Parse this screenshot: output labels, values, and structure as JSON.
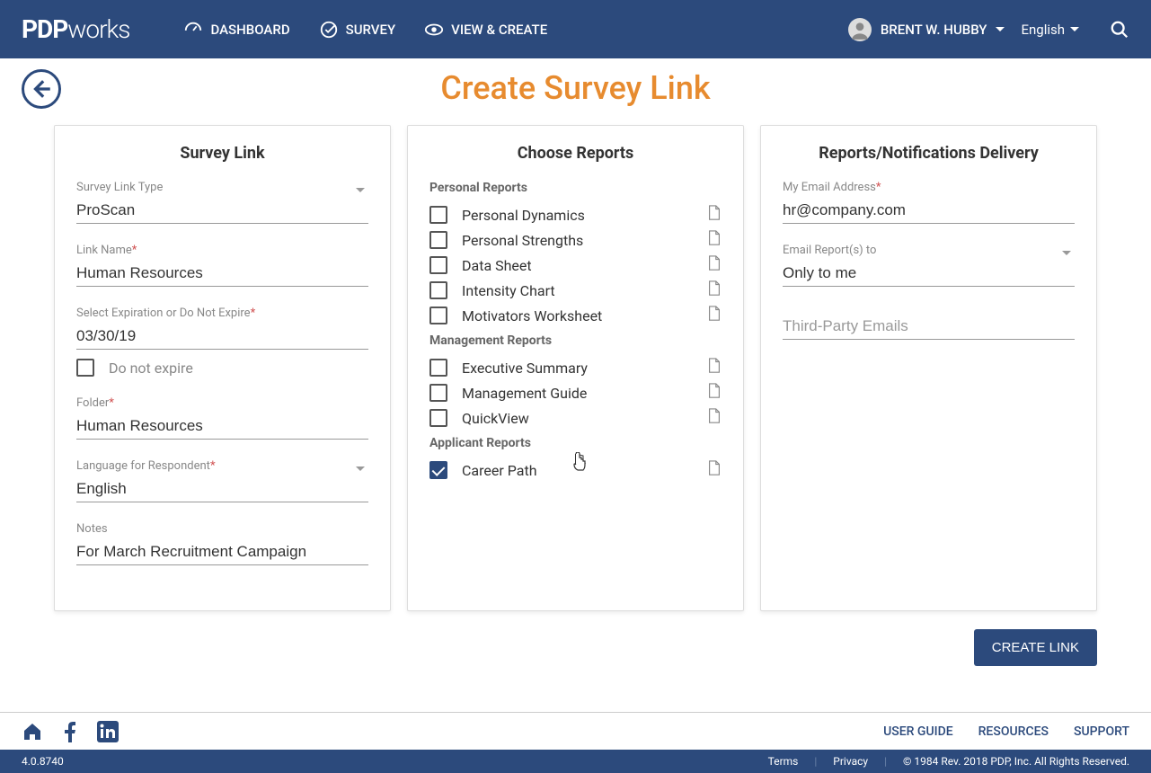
{
  "header": {
    "logo_bold": "PDP",
    "logo_light": "works",
    "nav": {
      "dashboard": "DASHBOARD",
      "survey": "SURVEY",
      "view_create": "VIEW & CREATE"
    },
    "user_name": "BRENT W. HUBBY",
    "language": "English"
  },
  "page_title": "Create Survey Link",
  "survey_link": {
    "card_title": "Survey Link",
    "type_label": "Survey Link Type",
    "type_value": "ProScan",
    "name_label": "Link Name",
    "name_value": "Human Resources",
    "expire_label": "Select Expiration or Do Not Expire",
    "expire_value": "03/30/19",
    "do_not_expire": "Do not expire",
    "folder_label": "Folder",
    "folder_value": "Human Resources",
    "lang_label": "Language for Respondent",
    "lang_value": "English",
    "notes_label": "Notes",
    "notes_value": "For March Recruitment Campaign"
  },
  "reports": {
    "card_title": "Choose Reports",
    "groups": [
      {
        "title": "Personal Reports",
        "items": [
          {
            "name": "Personal Dynamics",
            "checked": false
          },
          {
            "name": "Personal Strengths",
            "checked": false
          },
          {
            "name": "Data Sheet",
            "checked": false
          },
          {
            "name": "Intensity Chart",
            "checked": false
          },
          {
            "name": "Motivators Worksheet",
            "checked": false
          }
        ]
      },
      {
        "title": "Management Reports",
        "items": [
          {
            "name": "Executive Summary",
            "checked": false
          },
          {
            "name": "Management Guide",
            "checked": false
          },
          {
            "name": "QuickView",
            "checked": false
          }
        ]
      },
      {
        "title": "Applicant Reports",
        "items": [
          {
            "name": "Career Path",
            "checked": true
          }
        ]
      }
    ]
  },
  "delivery": {
    "card_title": "Reports/Notifications Delivery",
    "email_label": "My Email Address",
    "email_value": "hr@company.com",
    "send_label": "Email Report(s) to",
    "send_value": "Only to me",
    "third_party_placeholder": "Third-Party Emails"
  },
  "create_button": "CREATE LINK",
  "footer": {
    "links": {
      "user_guide": "USER GUIDE",
      "resources": "RESOURCES",
      "support": "SUPPORT"
    },
    "version": "4.0.8740",
    "terms": "Terms",
    "privacy": "Privacy",
    "copyright": "© 1984 Rev. 2018 PDP, Inc. All Rights Reserved."
  }
}
